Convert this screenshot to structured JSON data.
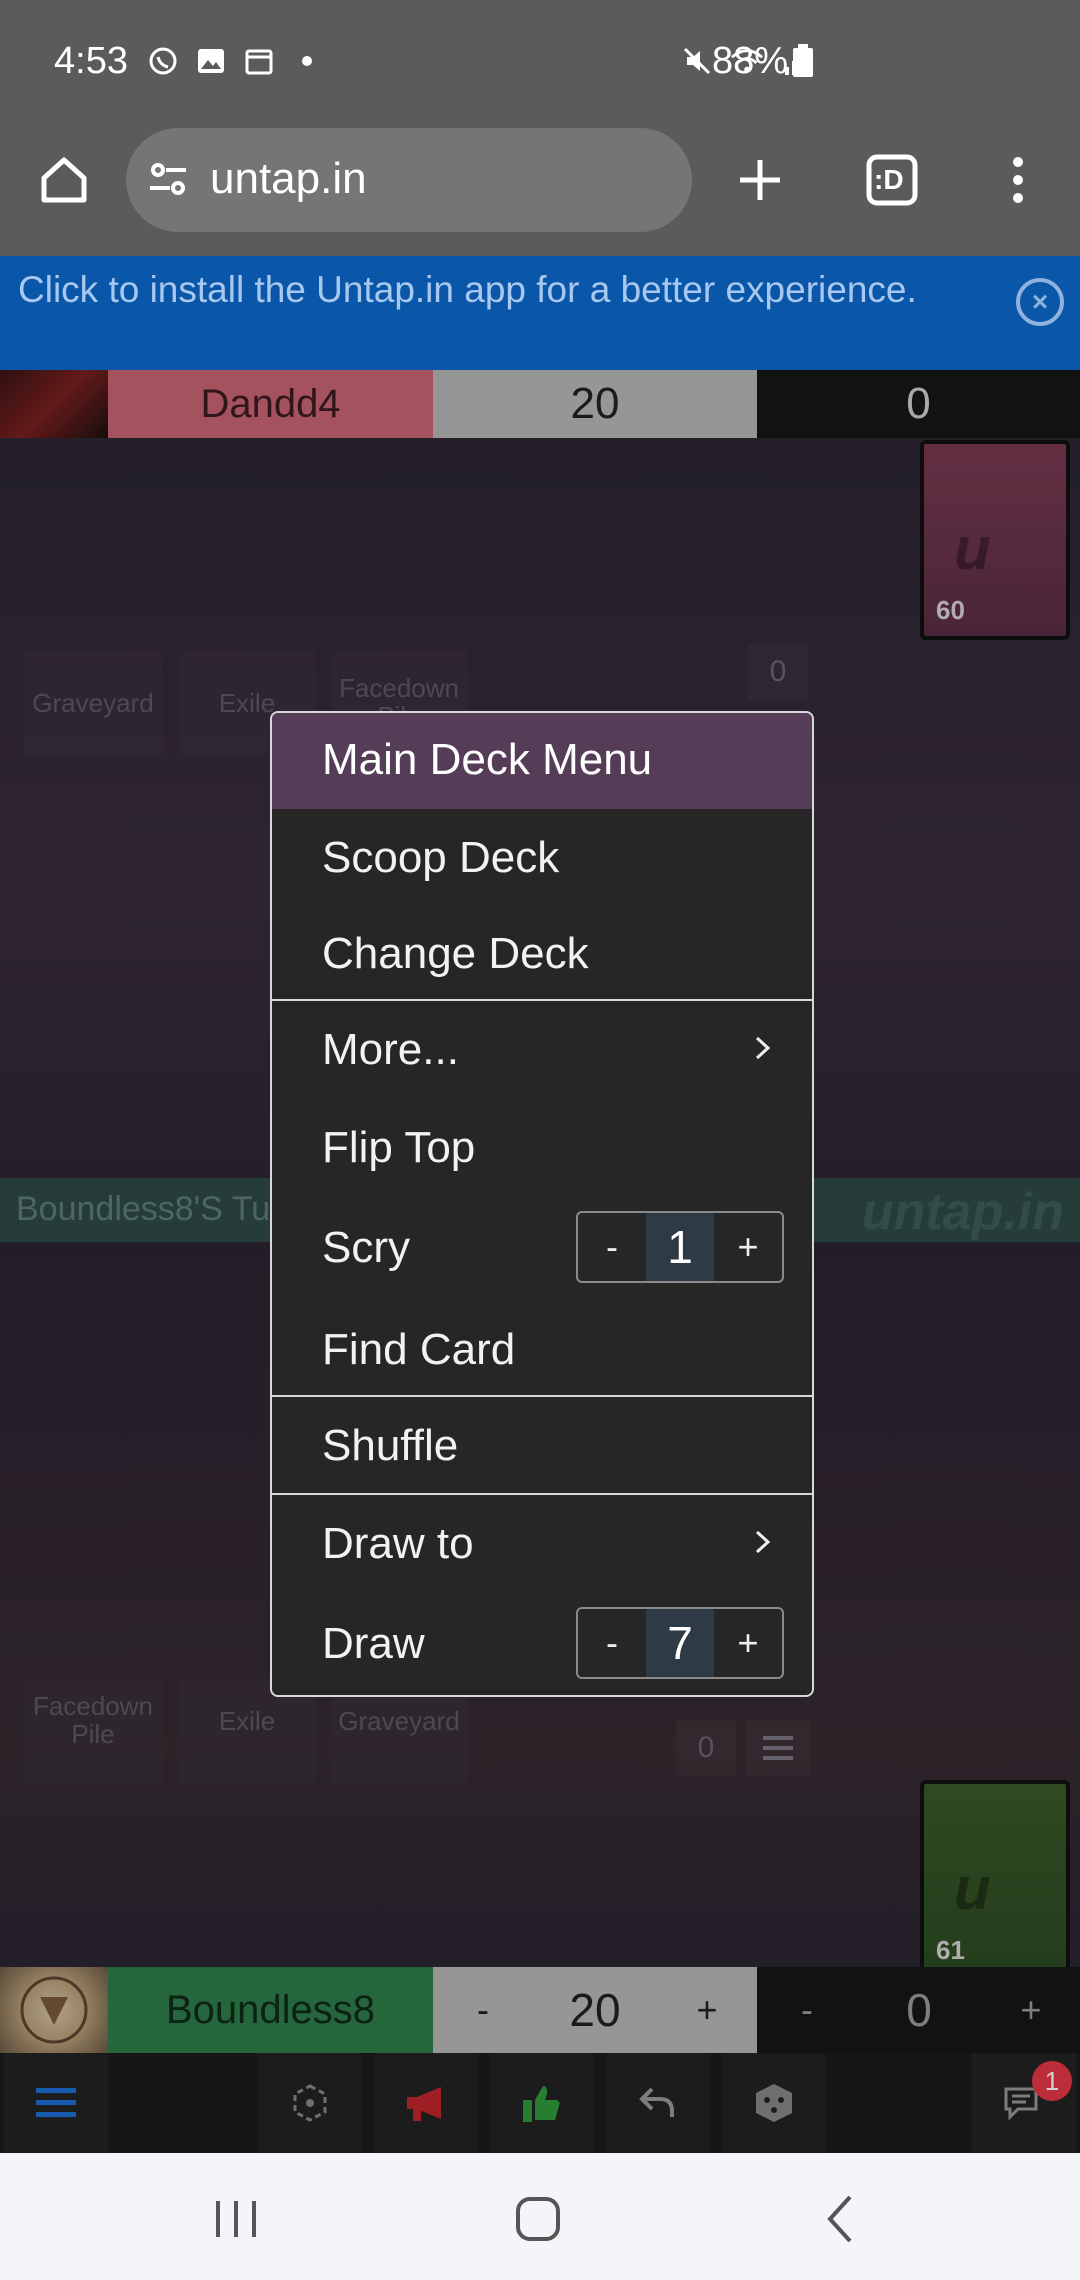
{
  "status_bar": {
    "time": "4:53",
    "battery": "88%",
    "left_icons": [
      "viber-icon",
      "gallery-icon",
      "calendar-icon",
      "dot-icon"
    ],
    "right_icons": [
      "mute-icon",
      "wifi-icon",
      "signal-icon",
      "battery-icon"
    ]
  },
  "browser": {
    "url": "untap.in",
    "tab_count_label": ":D"
  },
  "install_banner": {
    "text": "Click to install the Untap.in app for a better experience."
  },
  "opponent": {
    "name": "Dandd4",
    "life": "20",
    "poison": "0",
    "zones": {
      "graveyard": "Graveyard",
      "exile": "Exile",
      "facedown": "Facedown Pile"
    },
    "counter": "0",
    "deck_count": "60"
  },
  "turn_strip": {
    "text": "Boundless8'S Turn",
    "watermark": "untap.in"
  },
  "player": {
    "name": "Boundless8",
    "life": "20",
    "poison": "0",
    "minus": "-",
    "plus": "+",
    "zones": {
      "facedown": "Facedown Pile",
      "exile": "Exile",
      "graveyard": "Graveyard"
    },
    "counter": "0",
    "deck_count": "61"
  },
  "menu": {
    "title": "Main Deck Menu",
    "items": {
      "scoop": "Scoop Deck",
      "change": "Change Deck",
      "more": "More...",
      "flip_top": "Flip Top",
      "scry": "Scry",
      "find_card": "Find Card",
      "shuffle": "Shuffle",
      "draw_to": "Draw to",
      "draw": "Draw"
    },
    "scry_value": "1",
    "draw_value": "7",
    "minus": "-",
    "plus": "+"
  },
  "action_bar": {
    "icons": [
      "menu-icon",
      "token-icon",
      "megaphone-icon",
      "thumbs-up-icon",
      "undo-icon",
      "dice-icon",
      "chat-icon"
    ],
    "chat_badge": "1"
  },
  "colors": {
    "browser_chrome": "#5b5b5b",
    "banner_blue": "#0a56a8",
    "opponent_name": "#c96472",
    "player_name": "#2e7d4a",
    "menu_header": "#553d57",
    "menu_bg": "#262626"
  }
}
